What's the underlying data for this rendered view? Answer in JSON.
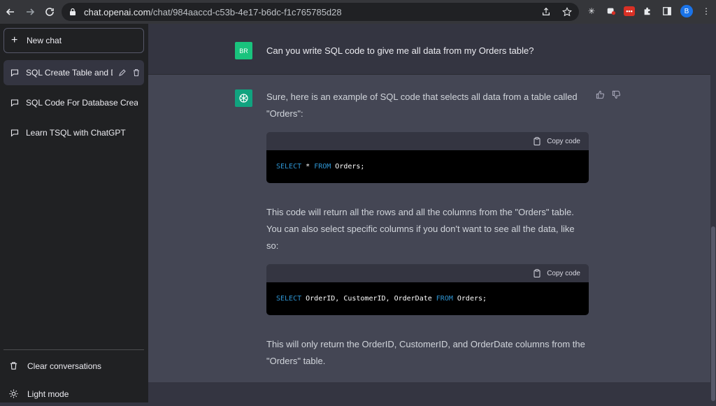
{
  "browser": {
    "url_host": "chat.openai.com",
    "url_path": "/chat/984aaccd-c53b-4e17-b6dc-f1c765785d28",
    "profile_initial": "B"
  },
  "sidebar": {
    "new_chat_label": "New chat",
    "conversations": [
      {
        "label": "SQL Create Table and D",
        "active": true
      },
      {
        "label": "SQL Code For Database Creati",
        "active": false
      },
      {
        "label": "Learn TSQL with ChatGPT",
        "active": false
      }
    ],
    "clear_label": "Clear conversations",
    "light_mode_label": "Light mode"
  },
  "chat": {
    "user_initials": "BR",
    "user_message": "Can you write SQL code to give me all data from my Orders table?",
    "ai_intro": "Sure, here is an example of SQL code that selects all data from a table called \"Orders\":",
    "copy_label": "Copy code",
    "code1": {
      "k1": "SELECT",
      "t1": " * ",
      "k2": "FROM",
      "t2": " Orders;"
    },
    "ai_middle": "This code will return all the rows and all the columns from the \"Orders\" table. You can also select specific columns if you don't want to see all the data, like so:",
    "code2": {
      "k1": "SELECT",
      "t1": " OrderID, CustomerID, OrderDate ",
      "k2": "FROM",
      "t2": " Orders;"
    },
    "ai_outro": "This will only return the OrderID, CustomerID, and OrderDate columns from the \"Orders\" table."
  },
  "colors": {
    "sidebar_bg": "#202123",
    "main_bg": "#343541",
    "ai_row_bg": "#444654",
    "user_avatar": "#19c37d",
    "ai_avatar": "#10a37f",
    "code_keyword": "#2e95d3"
  }
}
